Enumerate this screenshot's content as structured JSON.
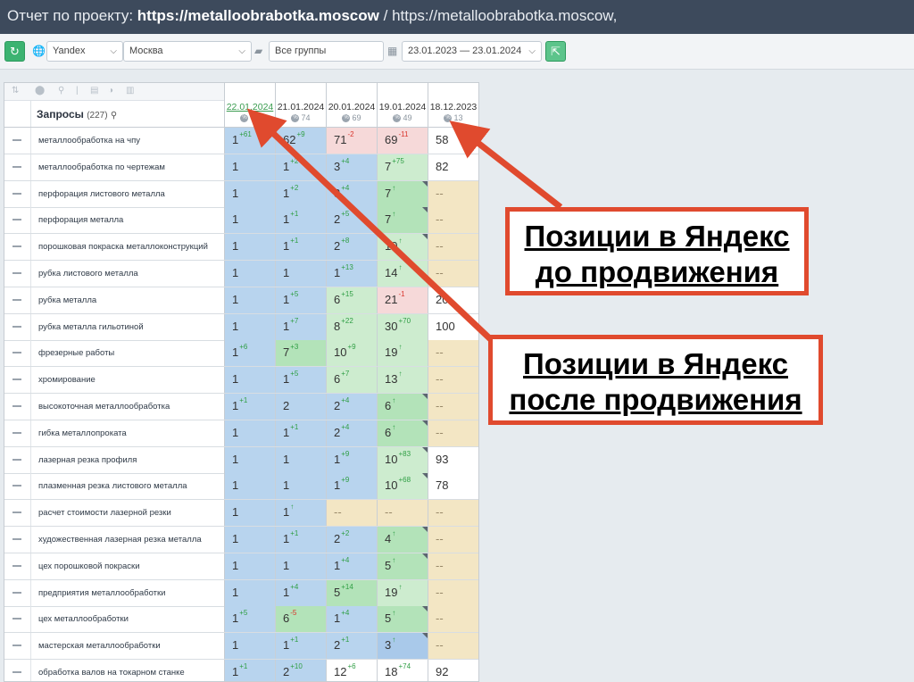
{
  "title": {
    "lead": "Отчет по проекту:",
    "project_bold": "https://metalloobrabotka.moscow",
    "separator": "/",
    "project_rest": "https://metalloobrabotka.moscow,"
  },
  "toolbar": {
    "refresh_icon": "refresh-icon",
    "engine": "Yandex",
    "region": "Москва",
    "group": "Все группы",
    "date_range": "23.01.2023 — 23.01.2024",
    "export_icon": "export-icon"
  },
  "table": {
    "header_title": "Запросы",
    "header_count": "(227)",
    "dates": [
      {
        "date": "22.01.2024",
        "pct": "78"
      },
      {
        "date": "21.01.2024",
        "pct": "74"
      },
      {
        "date": "20.01.2024",
        "pct": "69"
      },
      {
        "date": "19.01.2024",
        "pct": "49"
      },
      {
        "date": "18.12.2023",
        "pct": "13"
      }
    ],
    "rows": [
      {
        "query": "металлообработка на чпу",
        "cells": [
          {
            "v": "1",
            "d": "61",
            "dir": "up",
            "c": "c-blue"
          },
          {
            "v": "62",
            "d": "9",
            "dir": "up",
            "c": "c-blue"
          },
          {
            "v": "71",
            "d": "2",
            "dir": "down",
            "c": "c-red"
          },
          {
            "v": "69",
            "d": "11",
            "dir": "down",
            "c": "c-red"
          },
          {
            "v": "58",
            "d": "",
            "dir": "",
            "c": "c-white"
          }
        ]
      },
      {
        "query": "металлообработка по чертежам",
        "cells": [
          {
            "v": "1",
            "d": "",
            "dir": "",
            "c": "c-blue"
          },
          {
            "v": "1",
            "d": "2",
            "dir": "up",
            "c": "c-blue"
          },
          {
            "v": "3",
            "d": "4",
            "dir": "up",
            "c": "c-blue"
          },
          {
            "v": "7",
            "d": "75",
            "dir": "up",
            "c": "c-green"
          },
          {
            "v": "82",
            "d": "",
            "dir": "",
            "c": "c-white"
          }
        ]
      },
      {
        "query": "перфорация листового металла",
        "cells": [
          {
            "v": "1",
            "d": "",
            "dir": "",
            "c": "c-blue"
          },
          {
            "v": "1",
            "d": "2",
            "dir": "up",
            "c": "c-blue"
          },
          {
            "v": "3",
            "d": "4",
            "dir": "up",
            "c": "c-blue"
          },
          {
            "v": "7",
            "d": "↑",
            "dir": "up",
            "c": "c-green-dark",
            "tri": true
          },
          {
            "v": "--",
            "d": "",
            "dir": "",
            "c": "c-yellow"
          }
        ]
      },
      {
        "query": "перфорация металла",
        "cells": [
          {
            "v": "1",
            "d": "",
            "dir": "",
            "c": "c-blue"
          },
          {
            "v": "1",
            "d": "1",
            "dir": "up",
            "c": "c-blue"
          },
          {
            "v": "2",
            "d": "5",
            "dir": "up",
            "c": "c-blue"
          },
          {
            "v": "7",
            "d": "↑",
            "dir": "up",
            "c": "c-green-dark",
            "tri": true
          },
          {
            "v": "--",
            "d": "",
            "dir": "",
            "c": "c-yellow"
          }
        ]
      },
      {
        "query": "порошковая покраска металлоконструкций",
        "cells": [
          {
            "v": "1",
            "d": "",
            "dir": "",
            "c": "c-blue"
          },
          {
            "v": "1",
            "d": "1",
            "dir": "up",
            "c": "c-blue"
          },
          {
            "v": "2",
            "d": "8",
            "dir": "up",
            "c": "c-blue"
          },
          {
            "v": "10",
            "d": "↑",
            "dir": "up",
            "c": "c-green",
            "tri": true
          },
          {
            "v": "--",
            "d": "",
            "dir": "",
            "c": "c-yellow"
          }
        ]
      },
      {
        "query": "рубка листового металла",
        "cells": [
          {
            "v": "1",
            "d": "",
            "dir": "",
            "c": "c-blue"
          },
          {
            "v": "1",
            "d": "",
            "dir": "",
            "c": "c-blue"
          },
          {
            "v": "1",
            "d": "13",
            "dir": "up",
            "c": "c-blue"
          },
          {
            "v": "14",
            "d": "↑",
            "dir": "up",
            "c": "c-green"
          },
          {
            "v": "--",
            "d": "",
            "dir": "",
            "c": "c-yellow"
          }
        ]
      },
      {
        "query": "рубка металла",
        "cells": [
          {
            "v": "1",
            "d": "",
            "dir": "",
            "c": "c-blue"
          },
          {
            "v": "1",
            "d": "5",
            "dir": "up",
            "c": "c-blue"
          },
          {
            "v": "6",
            "d": "15",
            "dir": "up",
            "c": "c-green"
          },
          {
            "v": "21",
            "d": "1",
            "dir": "down",
            "c": "c-red"
          },
          {
            "v": "20",
            "d": "",
            "dir": "",
            "c": "c-white"
          }
        ]
      },
      {
        "query": "рубка металла гильотиной",
        "cells": [
          {
            "v": "1",
            "d": "",
            "dir": "",
            "c": "c-blue"
          },
          {
            "v": "1",
            "d": "7",
            "dir": "up",
            "c": "c-blue"
          },
          {
            "v": "8",
            "d": "22",
            "dir": "up",
            "c": "c-green"
          },
          {
            "v": "30",
            "d": "70",
            "dir": "up",
            "c": "c-green"
          },
          {
            "v": "100",
            "d": "",
            "dir": "",
            "c": "c-white"
          }
        ]
      },
      {
        "query": "фрезерные работы",
        "cells": [
          {
            "v": "1",
            "d": "6",
            "dir": "up",
            "c": "c-blue"
          },
          {
            "v": "7",
            "d": "3",
            "dir": "up",
            "c": "c-green-dark"
          },
          {
            "v": "10",
            "d": "9",
            "dir": "up",
            "c": "c-green"
          },
          {
            "v": "19",
            "d": "↑",
            "dir": "up",
            "c": "c-green"
          },
          {
            "v": "--",
            "d": "",
            "dir": "",
            "c": "c-yellow"
          }
        ]
      },
      {
        "query": "хромирование",
        "cells": [
          {
            "v": "1",
            "d": "",
            "dir": "",
            "c": "c-blue"
          },
          {
            "v": "1",
            "d": "5",
            "dir": "up",
            "c": "c-blue"
          },
          {
            "v": "6",
            "d": "7",
            "dir": "up",
            "c": "c-green"
          },
          {
            "v": "13",
            "d": "↑",
            "dir": "up",
            "c": "c-green"
          },
          {
            "v": "--",
            "d": "",
            "dir": "",
            "c": "c-yellow"
          }
        ]
      },
      {
        "query": "высокоточная металлообработка",
        "cells": [
          {
            "v": "1",
            "d": "1",
            "dir": "up",
            "c": "c-blue"
          },
          {
            "v": "2",
            "d": "",
            "dir": "",
            "c": "c-blue"
          },
          {
            "v": "2",
            "d": "4",
            "dir": "up",
            "c": "c-blue"
          },
          {
            "v": "6",
            "d": "↑",
            "dir": "up",
            "c": "c-green-dark",
            "tri": true
          },
          {
            "v": "--",
            "d": "",
            "dir": "",
            "c": "c-yellow"
          }
        ]
      },
      {
        "query": "гибка металлопроката",
        "cells": [
          {
            "v": "1",
            "d": "",
            "dir": "",
            "c": "c-blue"
          },
          {
            "v": "1",
            "d": "1",
            "dir": "up",
            "c": "c-blue"
          },
          {
            "v": "2",
            "d": "4",
            "dir": "up",
            "c": "c-blue"
          },
          {
            "v": "6",
            "d": "↑",
            "dir": "up",
            "c": "c-green-dark",
            "tri": true
          },
          {
            "v": "--",
            "d": "",
            "dir": "",
            "c": "c-yellow"
          }
        ]
      },
      {
        "query": "лазерная резка профиля",
        "cells": [
          {
            "v": "1",
            "d": "",
            "dir": "",
            "c": "c-blue"
          },
          {
            "v": "1",
            "d": "",
            "dir": "",
            "c": "c-blue"
          },
          {
            "v": "1",
            "d": "9",
            "dir": "up",
            "c": "c-blue"
          },
          {
            "v": "10",
            "d": "83",
            "dir": "up",
            "c": "c-green",
            "tri": true
          },
          {
            "v": "93",
            "d": "",
            "dir": "",
            "c": "c-white"
          }
        ]
      },
      {
        "query": "плазменная резка листового металла",
        "cells": [
          {
            "v": "1",
            "d": "",
            "dir": "",
            "c": "c-blue"
          },
          {
            "v": "1",
            "d": "",
            "dir": "",
            "c": "c-blue"
          },
          {
            "v": "1",
            "d": "9",
            "dir": "up",
            "c": "c-blue"
          },
          {
            "v": "10",
            "d": "68",
            "dir": "up",
            "c": "c-green",
            "tri": true
          },
          {
            "v": "78",
            "d": "",
            "dir": "",
            "c": "c-white"
          }
        ]
      },
      {
        "query": "расчет стоимости лазерной резки",
        "cells": [
          {
            "v": "1",
            "d": "",
            "dir": "",
            "c": "c-blue"
          },
          {
            "v": "1",
            "d": "↑",
            "dir": "up",
            "c": "c-blue"
          },
          {
            "v": "--",
            "d": "",
            "dir": "",
            "c": "c-yellow"
          },
          {
            "v": "--",
            "d": "",
            "dir": "",
            "c": "c-yellow"
          },
          {
            "v": "--",
            "d": "",
            "dir": "",
            "c": "c-yellow"
          }
        ]
      },
      {
        "query": "художественная лазерная резка металла",
        "cells": [
          {
            "v": "1",
            "d": "",
            "dir": "",
            "c": "c-blue"
          },
          {
            "v": "1",
            "d": "1",
            "dir": "up",
            "c": "c-blue"
          },
          {
            "v": "2",
            "d": "2",
            "dir": "up",
            "c": "c-blue"
          },
          {
            "v": "4",
            "d": "↑",
            "dir": "up",
            "c": "c-green-dark",
            "tri": true
          },
          {
            "v": "--",
            "d": "",
            "dir": "",
            "c": "c-yellow"
          }
        ]
      },
      {
        "query": "цех порошковой покраски",
        "cells": [
          {
            "v": "1",
            "d": "",
            "dir": "",
            "c": "c-blue"
          },
          {
            "v": "1",
            "d": "",
            "dir": "",
            "c": "c-blue"
          },
          {
            "v": "1",
            "d": "4",
            "dir": "up",
            "c": "c-blue"
          },
          {
            "v": "5",
            "d": "↑",
            "dir": "up",
            "c": "c-green-dark",
            "tri": true
          },
          {
            "v": "--",
            "d": "",
            "dir": "",
            "c": "c-yellow"
          }
        ]
      },
      {
        "query": "предприятия металлообработки",
        "cells": [
          {
            "v": "1",
            "d": "",
            "dir": "",
            "c": "c-blue"
          },
          {
            "v": "1",
            "d": "4",
            "dir": "up",
            "c": "c-blue"
          },
          {
            "v": "5",
            "d": "14",
            "dir": "up",
            "c": "c-green-dark"
          },
          {
            "v": "19",
            "d": "↑",
            "dir": "up",
            "c": "c-green"
          },
          {
            "v": "--",
            "d": "",
            "dir": "",
            "c": "c-yellow"
          }
        ]
      },
      {
        "query": "цех металлообработки",
        "cells": [
          {
            "v": "1",
            "d": "5",
            "dir": "up",
            "c": "c-blue"
          },
          {
            "v": "6",
            "d": "5",
            "dir": "down",
            "c": "c-green-dark"
          },
          {
            "v": "1",
            "d": "4",
            "dir": "up",
            "c": "c-blue"
          },
          {
            "v": "5",
            "d": "↑",
            "dir": "up",
            "c": "c-green-dark",
            "tri": true
          },
          {
            "v": "--",
            "d": "",
            "dir": "",
            "c": "c-yellow"
          }
        ]
      },
      {
        "query": "мастерская металлообработки",
        "cells": [
          {
            "v": "1",
            "d": "",
            "dir": "",
            "c": "c-blue"
          },
          {
            "v": "1",
            "d": "1",
            "dir": "up",
            "c": "c-blue"
          },
          {
            "v": "2",
            "d": "1",
            "dir": "up",
            "c": "c-blue"
          },
          {
            "v": "3",
            "d": "↑",
            "dir": "up",
            "c": "c-blue-dark",
            "tri": true
          },
          {
            "v": "--",
            "d": "",
            "dir": "",
            "c": "c-yellow"
          }
        ]
      },
      {
        "query": "обработка валов на токарном станке",
        "cells": [
          {
            "v": "1",
            "d": "1",
            "dir": "up",
            "c": "c-blue"
          },
          {
            "v": "2",
            "d": "10",
            "dir": "up",
            "c": "c-blue"
          },
          {
            "v": "12",
            "d": "6",
            "dir": "up",
            "c": "c-white"
          },
          {
            "v": "18",
            "d": "74",
            "dir": "up",
            "c": "c-white"
          },
          {
            "v": "92",
            "d": "",
            "dir": "",
            "c": "c-white"
          }
        ]
      }
    ]
  },
  "callouts": {
    "before": [
      "Позиции в Яндекс",
      "до продвижения"
    ],
    "after": [
      "Позиции в Яндекс",
      "после продвижения"
    ]
  },
  "colors": {
    "arrow": "#e04a2e",
    "titlebar": "#3d4a5c",
    "accent_green": "#3cb371"
  }
}
